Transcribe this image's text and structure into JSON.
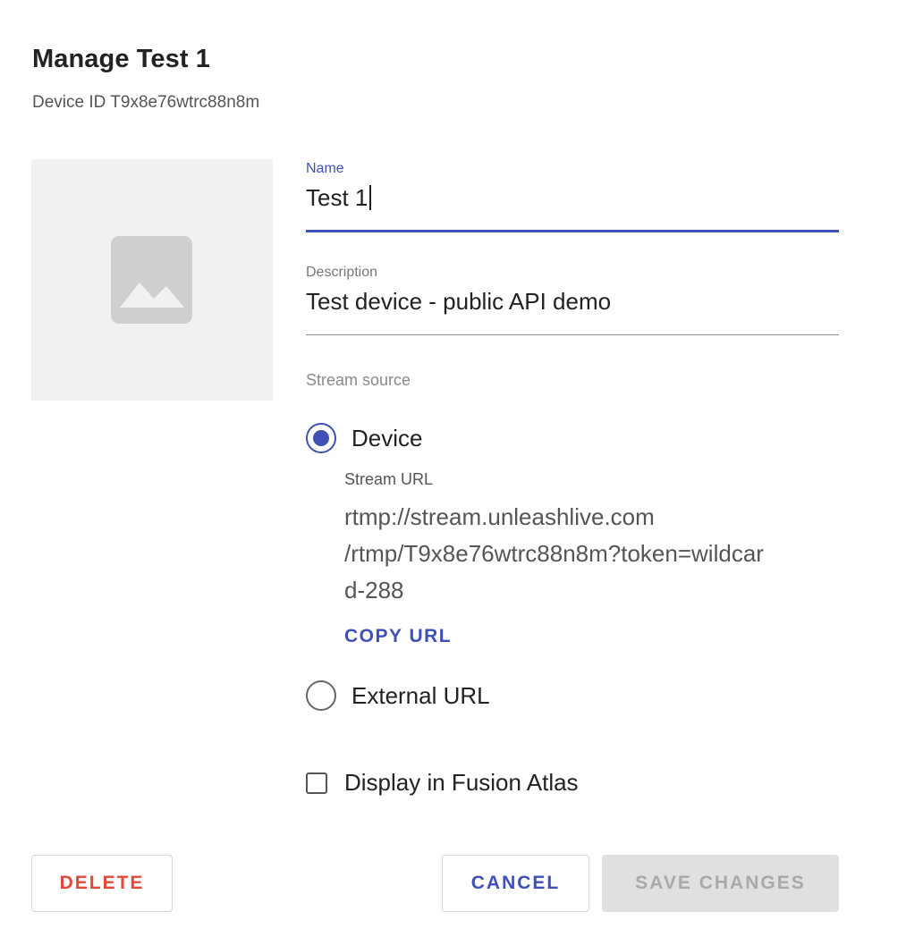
{
  "dialog": {
    "title": "Manage Test 1",
    "subtitle": "Device ID T9x8e76wtrc88n8m"
  },
  "image": {
    "icon": "image-placeholder-icon"
  },
  "fields": {
    "name": {
      "label": "Name",
      "value": "Test 1"
    },
    "description": {
      "label": "Description",
      "value": "Test device - public API demo"
    }
  },
  "stream": {
    "section_label": "Stream source",
    "selected": "device",
    "device_label": "Device",
    "url_label": "Stream URL",
    "url_lines": [
      "rtmp://stream.unleashlive.com",
      "/rtmp/T9x8e76wtrc88n8m?token=wildcar",
      "d-288"
    ],
    "copy_label": "COPY URL",
    "external_label": "External URL"
  },
  "fusion_atlas": {
    "label": "Display in Fusion Atlas",
    "checked": false
  },
  "actions": {
    "delete_label": "DELETE",
    "cancel_label": "CANCEL",
    "save_label": "SAVE CHANGES",
    "save_disabled": true
  },
  "colors": {
    "accent": "#3f51b5",
    "danger": "#e14a3b",
    "disabled_bg": "#e0e0e0",
    "disabled_text": "#a9a9a9"
  }
}
